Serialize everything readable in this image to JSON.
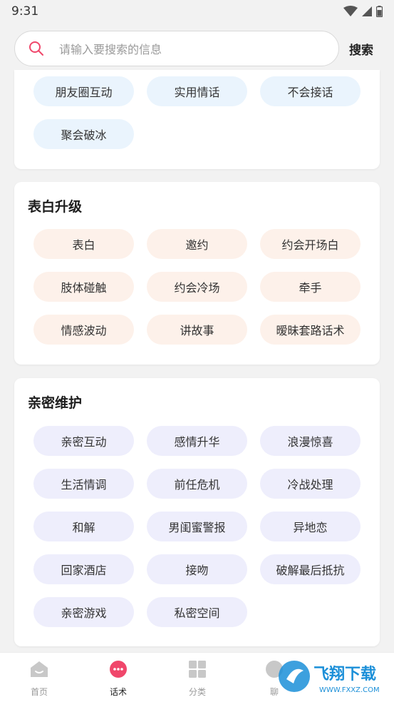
{
  "status": {
    "time": "9:31"
  },
  "search": {
    "placeholder": "请输入要搜索的信息",
    "button": "搜索"
  },
  "card1": {
    "chips": [
      "朋友圈互动",
      "实用情话",
      "不会接话",
      "聚会破冰"
    ]
  },
  "card2": {
    "title": "表白升级",
    "chips": [
      "表白",
      "邀约",
      "约会开场白",
      "肢体碰触",
      "约会冷场",
      "牵手",
      "情感波动",
      "讲故事",
      "暧昧套路话术"
    ]
  },
  "card3": {
    "title": "亲密维护",
    "chips": [
      "亲密互动",
      "感情升华",
      "浪漫惊喜",
      "生活情调",
      "前任危机",
      "冷战处理",
      "和解",
      "男闺蜜警报",
      "异地恋",
      "回家酒店",
      "接吻",
      "破解最后抵抗",
      "亲密游戏",
      "私密空间"
    ]
  },
  "nav": {
    "items": [
      {
        "label": "首页",
        "icon": "home-icon"
      },
      {
        "label": "话术",
        "icon": "chat-bubble-icon"
      },
      {
        "label": "分类",
        "icon": "grid-icon"
      },
      {
        "label": "聊",
        "icon": "chat-icon"
      }
    ]
  },
  "watermark": {
    "text": "飞翔下载",
    "url": "WWW.FXXZ.COM"
  },
  "colors": {
    "accent": "#f0476b",
    "chip_blue": "#eaf4fd",
    "chip_peach": "#fdf1ea",
    "chip_lavender": "#eeeefc",
    "watermark": "#1b8fd8"
  }
}
